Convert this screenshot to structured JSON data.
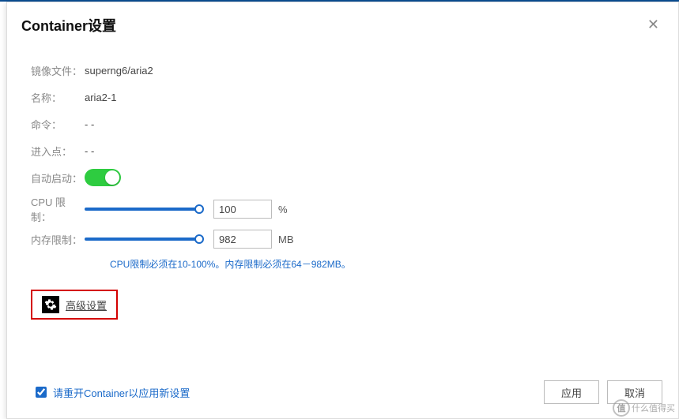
{
  "title": "Container设置",
  "fields": {
    "image_label": "镜像文件：",
    "image_value": "superng6/aria2",
    "name_label": "名称：",
    "name_value": "aria2-1",
    "cmd_label": "命令：",
    "cmd_value": "- -",
    "entry_label": "进入点：",
    "entry_value": "- -",
    "autostart_label": "自动启动：",
    "autostart_on": true,
    "cpu_label": "CPU 限制：",
    "cpu_value": "100",
    "cpu_unit": "%",
    "cpu_fill_color": "#1b6ac9",
    "mem_label": "内存限制：",
    "mem_value": "982",
    "mem_unit": "MB",
    "mem_fill_color": "#1b6ac9"
  },
  "hint": "CPU限制必须在10-100%。内存限制必须在64－982MB。",
  "advanced_label": "高级设置",
  "restart_checkbox_label": "请重开Container以应用新设置",
  "restart_checked": true,
  "buttons": {
    "apply": "应用",
    "cancel": "取消"
  },
  "watermark": {
    "badge": "值",
    "text": "什么值得买"
  }
}
